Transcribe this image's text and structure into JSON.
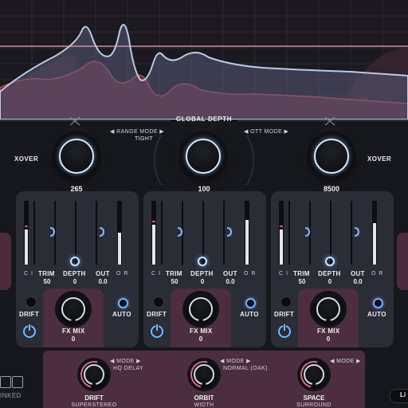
{
  "header": {
    "global_depth_label": "GLOBAL DEPTH",
    "range_mode_label": "◀ RANGE MODE ▶",
    "range_mode_value": "TIGHT",
    "ott_mode_label": "◀ OTT MODE ▶"
  },
  "knobs": {
    "xover_left": {
      "label": "XOVER",
      "value": "265"
    },
    "depth_center": {
      "value": "100"
    },
    "xover_right": {
      "label": "XOVER",
      "value": "8500"
    }
  },
  "bands": [
    {
      "ci_label": "C I",
      "trim_label": "TRIM",
      "trim_value": "50",
      "depth_label": "DEPTH",
      "depth_value": "0",
      "out_label": "OUT",
      "out_value": "0.0",
      "or_label": "O R",
      "drift_label": "DRIFT",
      "fxmix_label": "FX MIX",
      "fxmix_value": "0",
      "auto_label": "AUTO",
      "meter_in": 0.55,
      "meter_out": 0.5
    },
    {
      "ci_label": "C I",
      "trim_label": "TRIM",
      "trim_value": "50",
      "depth_label": "DEPTH",
      "depth_value": "0",
      "out_label": "OUT",
      "out_value": "0.0",
      "or_label": "O R",
      "drift_label": "DRIFT",
      "fxmix_label": "FX MIX",
      "fxmix_value": "0",
      "auto_label": "AUTO",
      "meter_in": 0.62,
      "meter_out": 0.7
    },
    {
      "ci_label": "C I",
      "trim_label": "TRIM",
      "trim_value": "50",
      "depth_label": "DEPTH",
      "depth_value": "0",
      "out_label": "OUT",
      "out_value": "0.0",
      "or_label": "O R",
      "drift_label": "DRIFT",
      "fxmix_label": "FX MIX",
      "fxmix_value": "0",
      "auto_label": "AUTO",
      "meter_in": 0.55,
      "meter_out": 0.65
    }
  ],
  "effects": [
    {
      "mode_label": "◀ MODE ▶",
      "mode_value": "HQ DELAY",
      "name": "DRIFT",
      "sub": "SUPERSTEREO"
    },
    {
      "mode_label": "◀ MODE ▶",
      "mode_value": "NORMAL (OAK)",
      "name": "ORBIT",
      "sub": "WIDTH"
    },
    {
      "mode_label": "◀ MODE ▶",
      "mode_value": "",
      "name": "SPACE",
      "sub": "SURROUND"
    }
  ],
  "footer": {
    "linked_label": "INKED",
    "right_badge": "Li"
  },
  "colors": {
    "background": "#17181d",
    "accent_blue": "#77b7ff",
    "accent_pink": "#d36b8c",
    "panel": "#2a2c36",
    "fx_panel": "#4b2e3f"
  },
  "icons": [
    "power-icon",
    "link-icon"
  ]
}
